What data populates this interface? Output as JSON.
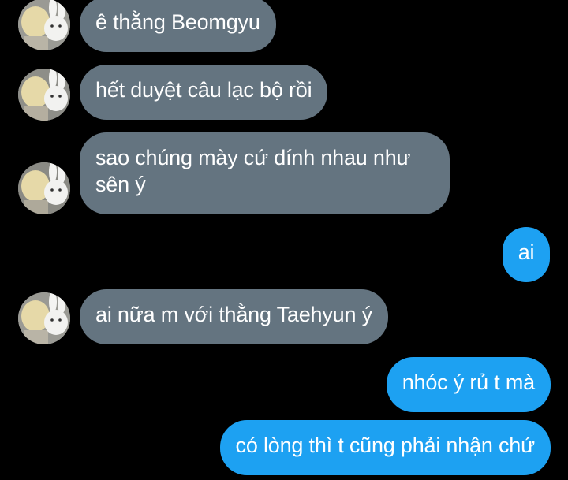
{
  "colors": {
    "background": "#000000",
    "incoming_bubble": "#647480",
    "outgoing_bubble": "#1da1f2",
    "text": "#ffffff"
  },
  "messages": [
    {
      "side": "incoming",
      "has_avatar": true,
      "text": "ê thằng Beomgyu"
    },
    {
      "side": "incoming",
      "has_avatar": true,
      "text": "hết duyệt câu lạc bộ rồi"
    },
    {
      "side": "incoming",
      "has_avatar": true,
      "text_lines": [
        "sao chúng mày cứ dính nhau như",
        "sên ý"
      ]
    },
    {
      "side": "outgoing",
      "has_avatar": false,
      "text": "ai"
    },
    {
      "side": "incoming",
      "has_avatar": true,
      "text": "ai nữa m với thằng Taehyun ý"
    },
    {
      "side": "outgoing",
      "has_avatar": false,
      "text": "nhóc ý rủ t mà"
    },
    {
      "side": "outgoing",
      "has_avatar": false,
      "text": "có lòng thì t cũng phải nhận chứ"
    }
  ]
}
